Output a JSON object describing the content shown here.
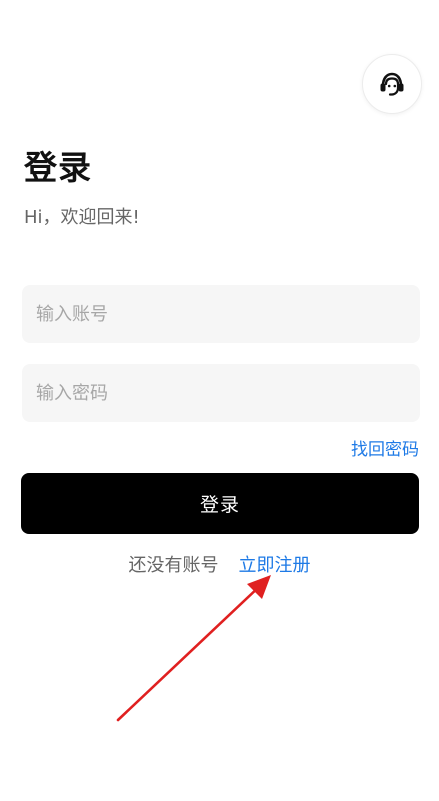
{
  "header": {
    "support_icon": "customer-service-icon"
  },
  "login": {
    "title": "登录",
    "subtitle": "Hi，欢迎回来!",
    "account_placeholder": "输入账号",
    "account_value": "",
    "password_placeholder": "输入密码",
    "password_value": "",
    "forgot_password": "找回密码",
    "login_button": "登录",
    "no_account_text": "还没有账号",
    "register_link": "立即注册"
  },
  "colors": {
    "accent": "#1e7ae6",
    "button_bg": "#000000",
    "field_bg": "#f6f6f6",
    "annotation_arrow": "#e02020"
  }
}
